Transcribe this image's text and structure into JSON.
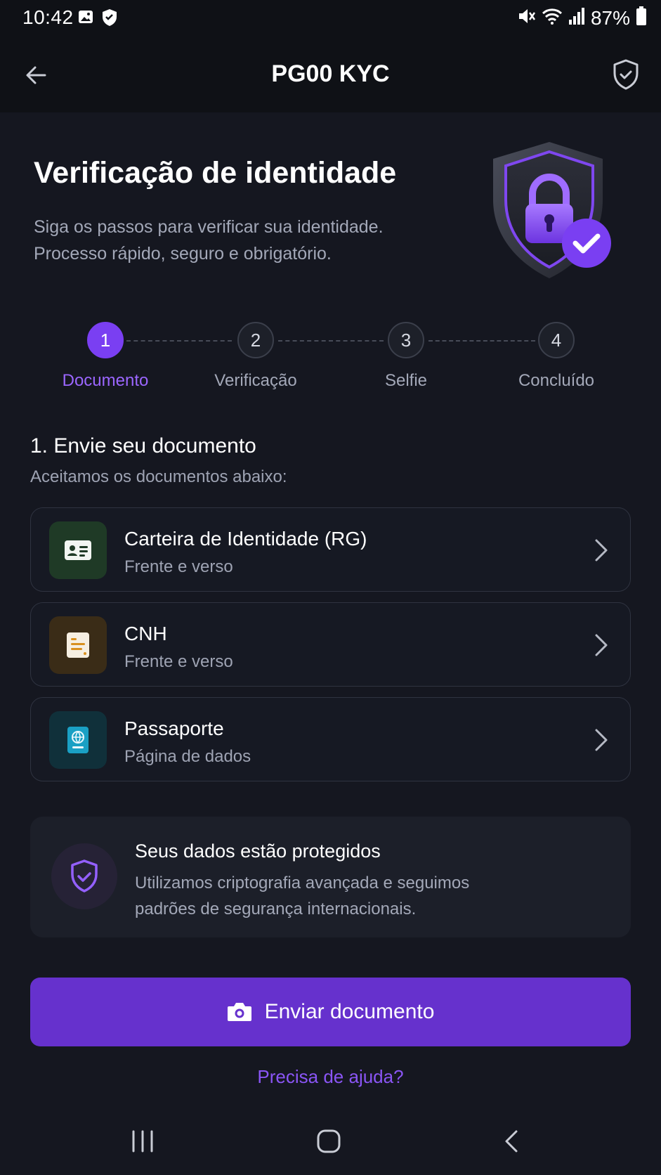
{
  "status_bar": {
    "time": "10:42",
    "battery": "87%",
    "icons": [
      "gallery-icon",
      "shield-icon",
      "mute-icon",
      "wifi-icon",
      "signal-icon",
      "battery-icon"
    ]
  },
  "app_bar": {
    "title": "PG00 KYC",
    "back_icon": "arrow-left-icon",
    "action_icon": "shield-check-icon"
  },
  "hero": {
    "title": "Verificação de identidade",
    "subtitle_lines": [
      "Siga os passos para verificar sua identidade.",
      "Processo rápido, seguro e obrigatório."
    ],
    "illustration": "shield-lock-check-icon"
  },
  "stepper": {
    "steps": [
      {
        "number": "1",
        "label": "Documento",
        "active": true
      },
      {
        "number": "2",
        "label": "Verificação",
        "active": false
      },
      {
        "number": "3",
        "label": "Selfie",
        "active": false
      },
      {
        "number": "4",
        "label": "Concluído",
        "active": false
      }
    ]
  },
  "documents_section": {
    "title": "1. Envie seu documento",
    "subtitle": "Aceitamos os documentos abaixo:",
    "items": [
      {
        "title": "Carteira de Identidade (RG)",
        "subtitle": "Frente e verso",
        "icon": "id-card-icon",
        "accent": "#1f3a26"
      },
      {
        "title": "CNH",
        "subtitle": "Frente e verso",
        "icon": "license-icon",
        "accent": "#3a2c17"
      },
      {
        "title": "Passaporte",
        "subtitle": "Página de dados",
        "icon": "passport-icon",
        "accent": "#10303a"
      }
    ]
  },
  "security_info": {
    "title": "Seus dados estão protegidos",
    "text_lines": [
      "Utilizamos criptografia avançada e seguimos",
      "padrões de segurança internacionais."
    ],
    "icon": "shield-check-icon"
  },
  "primary_action": {
    "label": "Enviar documento",
    "icon": "camera-icon"
  },
  "help_link": "Precisa de ajuda?",
  "colors": {
    "accent": "#6631cd",
    "accent_light": "#9b66ff",
    "background": "#151720"
  }
}
